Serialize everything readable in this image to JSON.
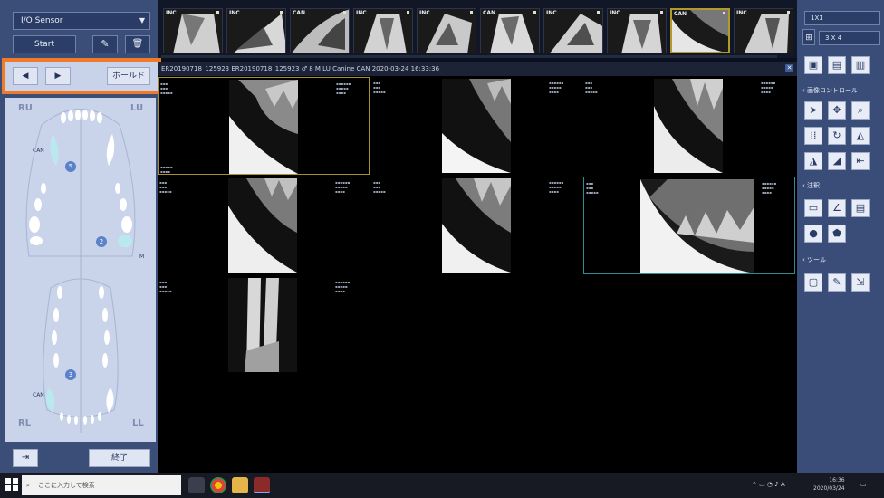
{
  "left_panel": {
    "sensor_select": "I/O Sensor",
    "start_label": "Start",
    "hold_label": "ホールド",
    "end_label": "終了",
    "quadrants": {
      "ru": "RU",
      "lu": "LU",
      "rl": "RL",
      "ll": "LL"
    },
    "tooth_labels": {
      "can_upper": "CAN",
      "can_lower": "CAN",
      "m": "M"
    },
    "badges": [
      "5",
      "2",
      "3"
    ]
  },
  "thumbnails": [
    {
      "tag": "INC"
    },
    {
      "tag": "INC"
    },
    {
      "tag": "CAN"
    },
    {
      "tag": "INC"
    },
    {
      "tag": "INC"
    },
    {
      "tag": "CAN"
    },
    {
      "tag": "INC"
    },
    {
      "tag": "INC"
    },
    {
      "tag": "CAN"
    },
    {
      "tag": "INC"
    }
  ],
  "info_bar": {
    "text": "ER20190718_125923   ER20190718_125923   ♂   8 M   LU Canine CAN   2020-03-24   16:33:36"
  },
  "right_panel": {
    "select_1": "1X1",
    "select_2": "3 X 4",
    "section_image": "画像コントロール",
    "section_annotation": "注釈",
    "section_tools": "ツール"
  },
  "taskbar": {
    "search_placeholder": "ここに入力して検索",
    "time": "16:36",
    "date": "2020/03/24"
  },
  "colors": {
    "orange_highlight": "#f07a2a",
    "selection_yellow": "#a8902b",
    "selection_teal": "#2f8c93",
    "panel_blue": "#3b4e78"
  }
}
